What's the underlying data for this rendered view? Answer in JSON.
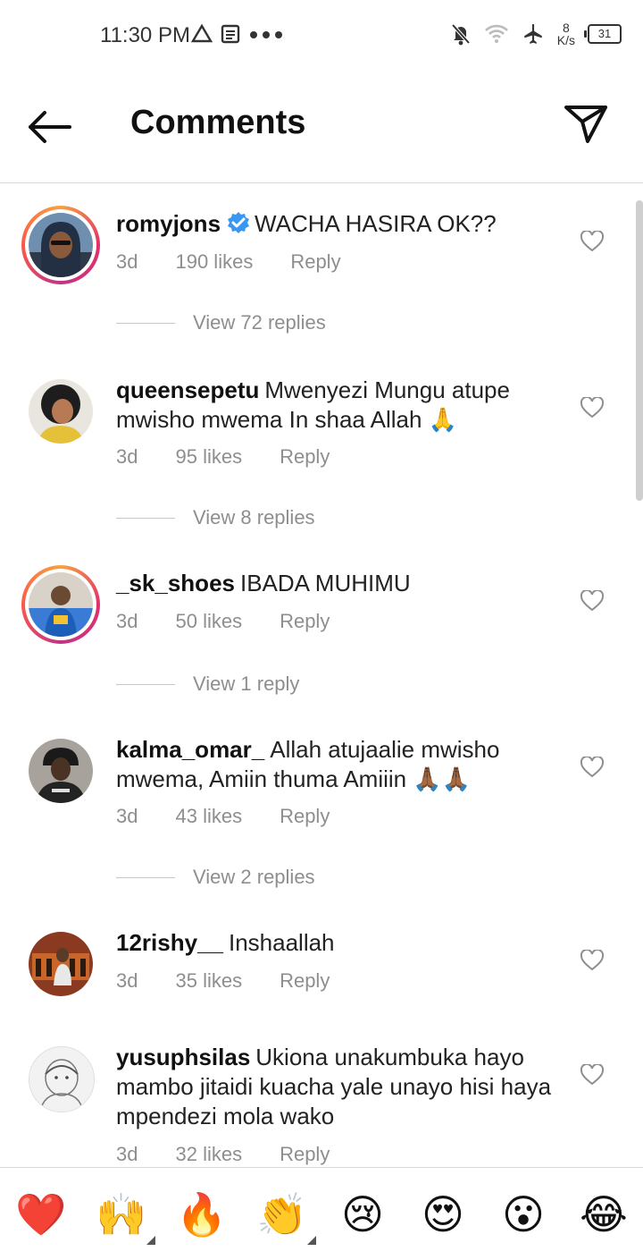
{
  "status_bar": {
    "time": "11:30 PM",
    "speed_value": "8",
    "speed_unit": "K/s",
    "battery": "31"
  },
  "header": {
    "title": "Comments"
  },
  "comments": [
    {
      "username": "romyjons",
      "verified": true,
      "text": "WACHA HASIRA OK??",
      "age": "3d",
      "likes": "190 likes",
      "reply": "Reply",
      "view_replies": "View 72 replies"
    },
    {
      "username": "queensepetu",
      "text": "Mwenyezi Mungu atupe mwisho mwema In shaa Allah 🙏",
      "age": "3d",
      "likes": "95 likes",
      "reply": "Reply",
      "view_replies": "View 8 replies"
    },
    {
      "username": "_sk_shoes",
      "text": "IBADA MUHIMU",
      "age": "3d",
      "likes": "50 likes",
      "reply": "Reply",
      "view_replies": "View 1 reply"
    },
    {
      "username": "kalma_omar_",
      "text": "Allah atujaalie mwisho mwema, Amiin thuma Amiiin 🙏🏾🙏🏾",
      "age": "3d",
      "likes": "43 likes",
      "reply": "Reply",
      "view_replies": "View 2 replies"
    },
    {
      "username": "12rishy__",
      "text": "Inshaallah",
      "age": "3d",
      "likes": "35 likes",
      "reply": "Reply"
    },
    {
      "username": "yusuphsilas",
      "text": "Ukiona unakumbuka hayo mambo jitaidi kuacha yale unayo hisi haya mpendezi mola wako",
      "age": "3d",
      "likes": "32 likes",
      "reply": "Reply"
    }
  ],
  "emoji_bar": [
    "❤️",
    "🙌",
    "🔥",
    "👏",
    "😢",
    "😍",
    "😮",
    "😂"
  ],
  "colors": {
    "secondary_text": "#8e8e8e",
    "verified": "#3897f0",
    "divider": "#dbdbdb"
  }
}
